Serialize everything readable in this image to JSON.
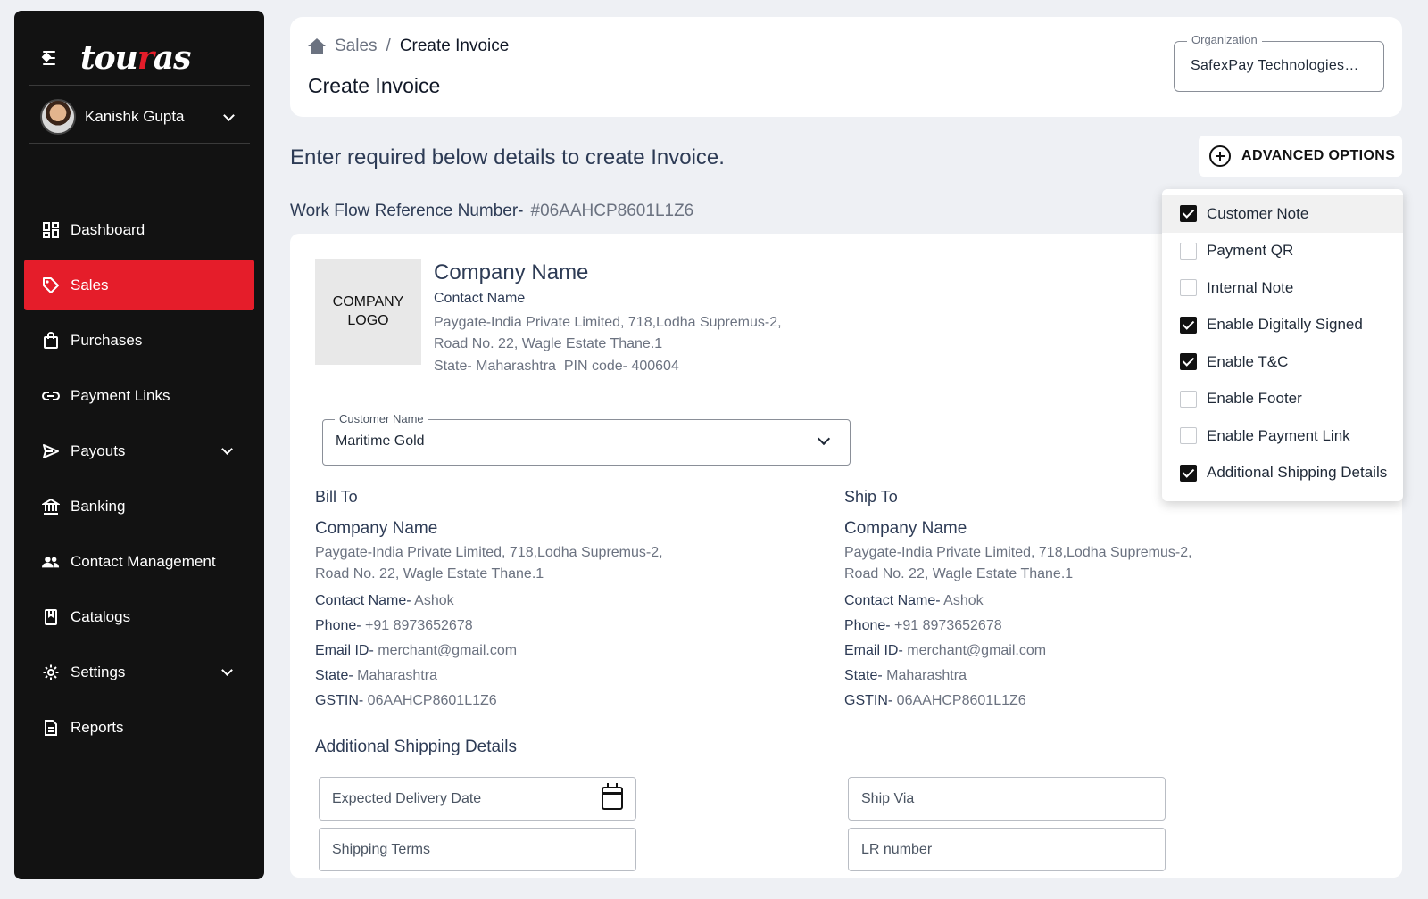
{
  "brand": {
    "logo_prefix": "tou",
    "logo_accent": "r",
    "logo_suffix": "as",
    "accent_color": "#e51d2a"
  },
  "user": {
    "name": "Kanishk Gupta"
  },
  "sidebar": {
    "items": [
      {
        "label": "Dashboard",
        "icon": "dashboard-icon"
      },
      {
        "label": "Sales",
        "icon": "tag-icon",
        "active": true
      },
      {
        "label": "Purchases",
        "icon": "shopping-bag-icon"
      },
      {
        "label": "Payment Links",
        "icon": "link-icon"
      },
      {
        "label": "Payouts",
        "icon": "send-icon",
        "expandable": true
      },
      {
        "label": "Banking",
        "icon": "bank-icon"
      },
      {
        "label": "Contact Management",
        "icon": "people-icon"
      },
      {
        "label": "Catalogs",
        "icon": "book-icon"
      },
      {
        "label": "Settings",
        "icon": "gear-icon",
        "expandable": true
      },
      {
        "label": "Reports",
        "icon": "document-icon"
      }
    ]
  },
  "header": {
    "breadcrumb": {
      "parent": "Sales",
      "separator": "/",
      "current": "Create Invoice"
    },
    "title": "Create Invoice",
    "organization": {
      "label": "Organization",
      "value": "SafexPay Technologies…"
    }
  },
  "form": {
    "subtitle": "Enter required below details to create Invoice.",
    "advanced_button": "ADVANCED OPTIONS",
    "workflow_label": "Work Flow Reference Number-",
    "workflow_number": "#06AAHCP8601L1Z6"
  },
  "company": {
    "logo_line1": "COMPANY",
    "logo_line2": "LOGO",
    "name": "Company Name",
    "contact": "Contact Name",
    "address_line1": "Paygate-India Private Limited, 718,Lodha Supremus-2,",
    "address_line2": "Road No. 22, Wagle Estate Thane.1",
    "state_pin": "State- Maharashtra  PIN code- 400604"
  },
  "customer": {
    "label": "Customer Name",
    "value": "Maritime Gold"
  },
  "bill_to": {
    "title": "Bill To",
    "company": "Company Name",
    "address_line1": "Paygate-India Private Limited, 718,Lodha Supremus-2,",
    "address_line2": "Road No. 22, Wagle Estate Thane.1",
    "contact_label": "Contact Name-",
    "contact_value": "Ashok",
    "phone_label": "Phone-",
    "phone_value": "+91 8973652678",
    "email_label": "Email ID-",
    "email_value": "merchant@gmail.com",
    "state_label": "State-",
    "state_value": "Maharashtra",
    "gstin_label": "GSTIN-",
    "gstin_value": "06AAHCP8601L1Z6"
  },
  "ship_to": {
    "title": "Ship To",
    "company": "Company Name",
    "address_line1": "Paygate-India Private Limited, 718,Lodha Supremus-2,",
    "address_line2": "Road No. 22, Wagle Estate Thane.1",
    "contact_label": "Contact Name-",
    "contact_value": "Ashok",
    "phone_label": "Phone-",
    "phone_value": "+91 8973652678",
    "email_label": "Email ID-",
    "email_value": "merchant@gmail.com",
    "state_label": "State-",
    "state_value": "Maharashtra",
    "gstin_label": "GSTIN-",
    "gstin_value": "06AAHCP8601L1Z6"
  },
  "additional_shipping": {
    "title": "Additional Shipping Details",
    "expected_delivery": "Expected Delivery Date",
    "ship_via": "Ship Via",
    "shipping_terms": "Shipping Terms",
    "lr_number": "LR number"
  },
  "advanced_options": [
    {
      "label": "Customer Note",
      "checked": true
    },
    {
      "label": "Payment QR",
      "checked": false
    },
    {
      "label": "Internal Note",
      "checked": false
    },
    {
      "label": "Enable Digitally Signed",
      "checked": true
    },
    {
      "label": "Enable T&C",
      "checked": true
    },
    {
      "label": "Enable Footer",
      "checked": false
    },
    {
      "label": "Enable Payment Link",
      "checked": false
    },
    {
      "label": "Additional Shipping Details",
      "checked": true
    }
  ]
}
